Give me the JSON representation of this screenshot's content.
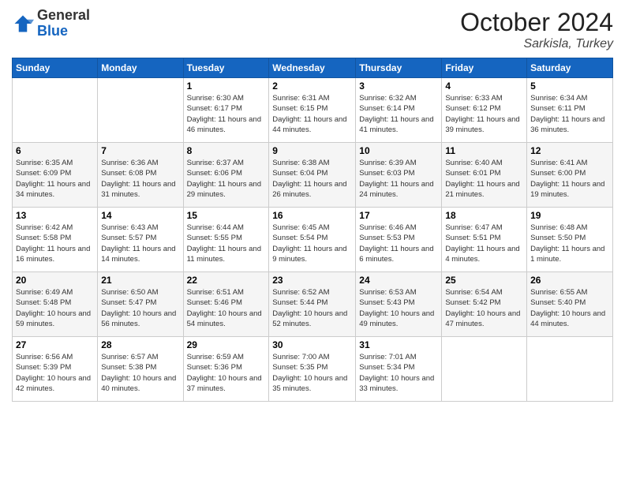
{
  "header": {
    "logo_general": "General",
    "logo_blue": "Blue",
    "month_year": "October 2024",
    "location": "Sarkisla, Turkey"
  },
  "days_of_week": [
    "Sunday",
    "Monday",
    "Tuesday",
    "Wednesday",
    "Thursday",
    "Friday",
    "Saturday"
  ],
  "weeks": [
    [
      {
        "day": "",
        "sunrise": "",
        "sunset": "",
        "daylight": ""
      },
      {
        "day": "",
        "sunrise": "",
        "sunset": "",
        "daylight": ""
      },
      {
        "day": "1",
        "sunrise": "Sunrise: 6:30 AM",
        "sunset": "Sunset: 6:17 PM",
        "daylight": "Daylight: 11 hours and 46 minutes."
      },
      {
        "day": "2",
        "sunrise": "Sunrise: 6:31 AM",
        "sunset": "Sunset: 6:15 PM",
        "daylight": "Daylight: 11 hours and 44 minutes."
      },
      {
        "day": "3",
        "sunrise": "Sunrise: 6:32 AM",
        "sunset": "Sunset: 6:14 PM",
        "daylight": "Daylight: 11 hours and 41 minutes."
      },
      {
        "day": "4",
        "sunrise": "Sunrise: 6:33 AM",
        "sunset": "Sunset: 6:12 PM",
        "daylight": "Daylight: 11 hours and 39 minutes."
      },
      {
        "day": "5",
        "sunrise": "Sunrise: 6:34 AM",
        "sunset": "Sunset: 6:11 PM",
        "daylight": "Daylight: 11 hours and 36 minutes."
      }
    ],
    [
      {
        "day": "6",
        "sunrise": "Sunrise: 6:35 AM",
        "sunset": "Sunset: 6:09 PM",
        "daylight": "Daylight: 11 hours and 34 minutes."
      },
      {
        "day": "7",
        "sunrise": "Sunrise: 6:36 AM",
        "sunset": "Sunset: 6:08 PM",
        "daylight": "Daylight: 11 hours and 31 minutes."
      },
      {
        "day": "8",
        "sunrise": "Sunrise: 6:37 AM",
        "sunset": "Sunset: 6:06 PM",
        "daylight": "Daylight: 11 hours and 29 minutes."
      },
      {
        "day": "9",
        "sunrise": "Sunrise: 6:38 AM",
        "sunset": "Sunset: 6:04 PM",
        "daylight": "Daylight: 11 hours and 26 minutes."
      },
      {
        "day": "10",
        "sunrise": "Sunrise: 6:39 AM",
        "sunset": "Sunset: 6:03 PM",
        "daylight": "Daylight: 11 hours and 24 minutes."
      },
      {
        "day": "11",
        "sunrise": "Sunrise: 6:40 AM",
        "sunset": "Sunset: 6:01 PM",
        "daylight": "Daylight: 11 hours and 21 minutes."
      },
      {
        "day": "12",
        "sunrise": "Sunrise: 6:41 AM",
        "sunset": "Sunset: 6:00 PM",
        "daylight": "Daylight: 11 hours and 19 minutes."
      }
    ],
    [
      {
        "day": "13",
        "sunrise": "Sunrise: 6:42 AM",
        "sunset": "Sunset: 5:58 PM",
        "daylight": "Daylight: 11 hours and 16 minutes."
      },
      {
        "day": "14",
        "sunrise": "Sunrise: 6:43 AM",
        "sunset": "Sunset: 5:57 PM",
        "daylight": "Daylight: 11 hours and 14 minutes."
      },
      {
        "day": "15",
        "sunrise": "Sunrise: 6:44 AM",
        "sunset": "Sunset: 5:55 PM",
        "daylight": "Daylight: 11 hours and 11 minutes."
      },
      {
        "day": "16",
        "sunrise": "Sunrise: 6:45 AM",
        "sunset": "Sunset: 5:54 PM",
        "daylight": "Daylight: 11 hours and 9 minutes."
      },
      {
        "day": "17",
        "sunrise": "Sunrise: 6:46 AM",
        "sunset": "Sunset: 5:53 PM",
        "daylight": "Daylight: 11 hours and 6 minutes."
      },
      {
        "day": "18",
        "sunrise": "Sunrise: 6:47 AM",
        "sunset": "Sunset: 5:51 PM",
        "daylight": "Daylight: 11 hours and 4 minutes."
      },
      {
        "day": "19",
        "sunrise": "Sunrise: 6:48 AM",
        "sunset": "Sunset: 5:50 PM",
        "daylight": "Daylight: 11 hours and 1 minute."
      }
    ],
    [
      {
        "day": "20",
        "sunrise": "Sunrise: 6:49 AM",
        "sunset": "Sunset: 5:48 PM",
        "daylight": "Daylight: 10 hours and 59 minutes."
      },
      {
        "day": "21",
        "sunrise": "Sunrise: 6:50 AM",
        "sunset": "Sunset: 5:47 PM",
        "daylight": "Daylight: 10 hours and 56 minutes."
      },
      {
        "day": "22",
        "sunrise": "Sunrise: 6:51 AM",
        "sunset": "Sunset: 5:46 PM",
        "daylight": "Daylight: 10 hours and 54 minutes."
      },
      {
        "day": "23",
        "sunrise": "Sunrise: 6:52 AM",
        "sunset": "Sunset: 5:44 PM",
        "daylight": "Daylight: 10 hours and 52 minutes."
      },
      {
        "day": "24",
        "sunrise": "Sunrise: 6:53 AM",
        "sunset": "Sunset: 5:43 PM",
        "daylight": "Daylight: 10 hours and 49 minutes."
      },
      {
        "day": "25",
        "sunrise": "Sunrise: 6:54 AM",
        "sunset": "Sunset: 5:42 PM",
        "daylight": "Daylight: 10 hours and 47 minutes."
      },
      {
        "day": "26",
        "sunrise": "Sunrise: 6:55 AM",
        "sunset": "Sunset: 5:40 PM",
        "daylight": "Daylight: 10 hours and 44 minutes."
      }
    ],
    [
      {
        "day": "27",
        "sunrise": "Sunrise: 6:56 AM",
        "sunset": "Sunset: 5:39 PM",
        "daylight": "Daylight: 10 hours and 42 minutes."
      },
      {
        "day": "28",
        "sunrise": "Sunrise: 6:57 AM",
        "sunset": "Sunset: 5:38 PM",
        "daylight": "Daylight: 10 hours and 40 minutes."
      },
      {
        "day": "29",
        "sunrise": "Sunrise: 6:59 AM",
        "sunset": "Sunset: 5:36 PM",
        "daylight": "Daylight: 10 hours and 37 minutes."
      },
      {
        "day": "30",
        "sunrise": "Sunrise: 7:00 AM",
        "sunset": "Sunset: 5:35 PM",
        "daylight": "Daylight: 10 hours and 35 minutes."
      },
      {
        "day": "31",
        "sunrise": "Sunrise: 7:01 AM",
        "sunset": "Sunset: 5:34 PM",
        "daylight": "Daylight: 10 hours and 33 minutes."
      },
      {
        "day": "",
        "sunrise": "",
        "sunset": "",
        "daylight": ""
      },
      {
        "day": "",
        "sunrise": "",
        "sunset": "",
        "daylight": ""
      }
    ]
  ]
}
